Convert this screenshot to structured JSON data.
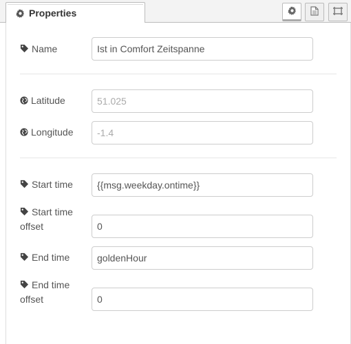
{
  "tab": {
    "title": "Properties",
    "icon": "gear-icon"
  },
  "toolbar": {
    "buttons": [
      {
        "name": "properties",
        "icon": "gear-icon",
        "active": true
      },
      {
        "name": "description",
        "icon": "document-icon",
        "active": false
      },
      {
        "name": "appearance",
        "icon": "frame-icon",
        "active": false
      }
    ]
  },
  "form": {
    "name": {
      "label": "Name",
      "icon": "tag-icon",
      "value": "Ist in Comfort Zeitspanne"
    },
    "latitude": {
      "label": "Latitude",
      "icon": "globe-icon",
      "placeholder": "51.025"
    },
    "longitude": {
      "label": "Longitude",
      "icon": "globe-icon",
      "placeholder": "-1.4"
    },
    "start_time": {
      "label": "Start time",
      "icon": "tag-icon",
      "value": "{{msg.weekday.ontime}}"
    },
    "start_time_offset": {
      "label_line1": "Start time",
      "label_line2": "offset",
      "icon": "tag-icon",
      "value": "0"
    },
    "end_time": {
      "label": "End time",
      "icon": "tag-icon",
      "value": "goldenHour"
    },
    "end_time_offset": {
      "label_line1": "End time",
      "label_line2": "offset",
      "icon": "tag-icon",
      "value": "0"
    }
  },
  "colors": {
    "border": "#cccccc",
    "text": "#555555",
    "placeholder": "#999999",
    "tabbar": "#f3f3f3"
  }
}
